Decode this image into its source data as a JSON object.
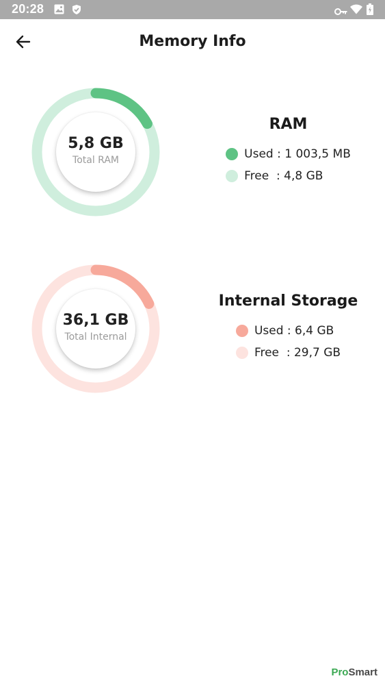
{
  "status_bar": {
    "time": "20:28"
  },
  "app_bar": {
    "title": "Memory Info"
  },
  "ram": {
    "title": "RAM",
    "total_value": "5,8 GB",
    "total_label": "Total RAM",
    "used_fraction": 0.17,
    "used_label": "Used : ",
    "used_value": "1 003,5 MB",
    "free_label": "Free  : ",
    "free_value": "4,8 GB",
    "used_color": "#5ec384",
    "free_color": "#cfeedd"
  },
  "storage": {
    "title": "Internal Storage",
    "total_value": "36,1 GB",
    "total_label": "Total Internal",
    "used_fraction": 0.18,
    "used_label": "Used : ",
    "used_value": "6,4 GB",
    "free_label": "Free  : ",
    "free_value": "29,7 GB",
    "used_color": "#f7a99b",
    "free_color": "#fde3df"
  },
  "watermark": {
    "pro": "Pro",
    "smart": "Smart"
  }
}
